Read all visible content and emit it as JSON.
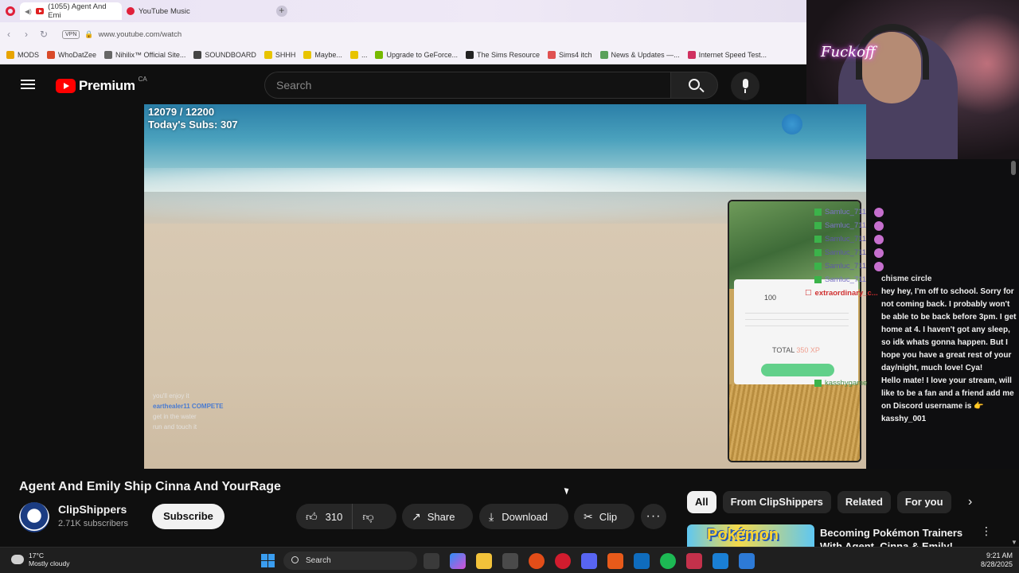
{
  "browser": {
    "tabs": [
      {
        "label": "(1055) Agent And Emi",
        "active": true
      },
      {
        "label": "YouTube Music",
        "active": false
      }
    ],
    "url": "www.youtube.com/watch",
    "vpn_label": "VPN",
    "bookmarks": [
      "MODS",
      "WhoDatZee",
      "Nihilix™ Official Site...",
      "SOUNDBOARD",
      "SHHH",
      "Maybe...",
      "...",
      "Upgrade to GeForce...",
      "The Sims Resource",
      "Sims4 itch",
      "News & Updates —...",
      "Internet Speed Test..."
    ]
  },
  "webcam": {
    "neon_text": "Fuckoff"
  },
  "youtube": {
    "brand": "Premium",
    "region": "CA",
    "search_placeholder": "Search"
  },
  "video": {
    "sub_goal": "12079 / 12200",
    "todays_subs": "Today's Subs: 307",
    "overlay_chat": [
      "you'll enjoy it",
      "earthealer11  COMPETE",
      "get in the water",
      "run and touch it"
    ],
    "phone": {
      "xp": "100",
      "total_label": "TOTAL",
      "total_value": "350 XP"
    }
  },
  "stream_chat": {
    "usernames": [
      "Samluc_711",
      "Samluc_711",
      "Samluc_711",
      "Samluc_711",
      "Samluc_711",
      "Samluc_711"
    ],
    "extra_user": "extraordinary_c...",
    "last_user": "kasshygame",
    "messages": [
      "chisme circle",
      "hey hey, I'm off to school. Sorry for not coming back. I probably won't be able to be back before 3pm. I get home at 4. I haven't got any sleep, so idk whats gonna happen. But I hope you have a great rest of your day/night, much love! Cya!",
      "Hello mate! I love your stream, will like to be a fan and a friend add me on Discord username is 👉 kasshy_001"
    ]
  },
  "info": {
    "title": "Agent And Emily Ship Cinna And YourRage",
    "channel": "ClipShippers",
    "subscribers": "2.71K subscribers",
    "subscribe_label": "Subscribe",
    "likes": "310",
    "share_label": "Share",
    "download_label": "Download",
    "clip_label": "Clip",
    "more_label": "···"
  },
  "chips": [
    "All",
    "From ClipShippers",
    "Related",
    "For you"
  ],
  "recommended": {
    "thumb_text": "Pokémon",
    "title": "Becoming Pokémon Trainers With Agent, Cinna & Emily!"
  },
  "taskbar": {
    "temp": "17°C",
    "weather": "Mostly cloudy",
    "search": "Search",
    "time": "9:21 AM",
    "date": "8/28/2025"
  },
  "colors": {
    "accent_red": "#ff0000",
    "chat_name": "#7b74c6",
    "bg": "#0f0f0f"
  }
}
